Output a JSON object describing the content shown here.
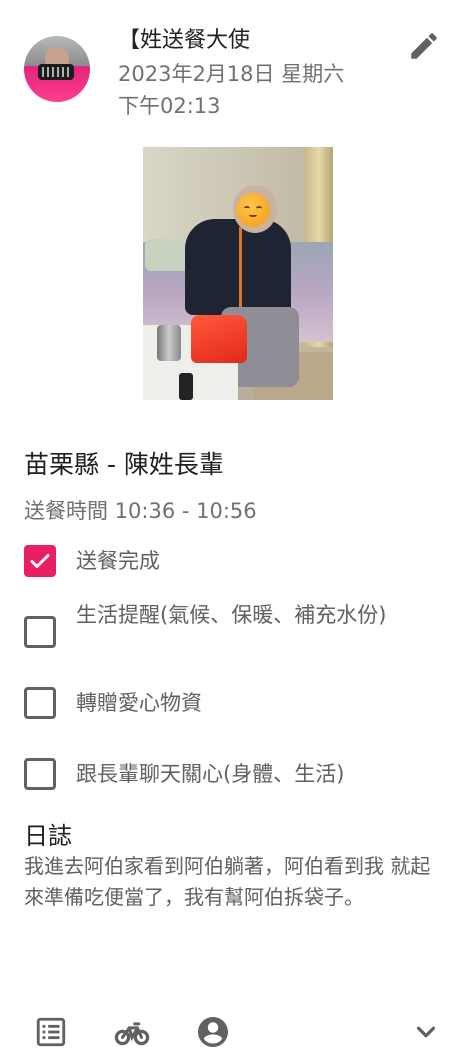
{
  "header": {
    "title": "【姓送餐大使",
    "date": "2023年2月18日 星期六",
    "time": "下午02:13"
  },
  "icons": {
    "edit": "pencil-icon",
    "list": "list-icon",
    "bike": "bike-icon",
    "profile": "account-icon",
    "expand": "chevron-down-icon"
  },
  "colors": {
    "accent": "#e91e63",
    "text_primary": "#212121",
    "text_secondary": "#707070",
    "icon": "#616161"
  },
  "visit": {
    "place": "苗栗縣 - 陳姓長輩",
    "time_range": "送餐時間 10:36 - 10:56"
  },
  "checklist": [
    {
      "label": "送餐完成",
      "checked": true
    },
    {
      "label": "生活提醒(氣候、保暖、補充水份)",
      "checked": false
    },
    {
      "label": "轉贈愛心物資",
      "checked": false
    },
    {
      "label": "跟長輩聊天關心(身體、生活)",
      "checked": false
    }
  ],
  "log": {
    "title": "日誌",
    "text": "我進去阿伯家看到阿伯躺著，阿伯看到我 就起來準備吃便當了，我有幫阿伯拆袋子。"
  }
}
